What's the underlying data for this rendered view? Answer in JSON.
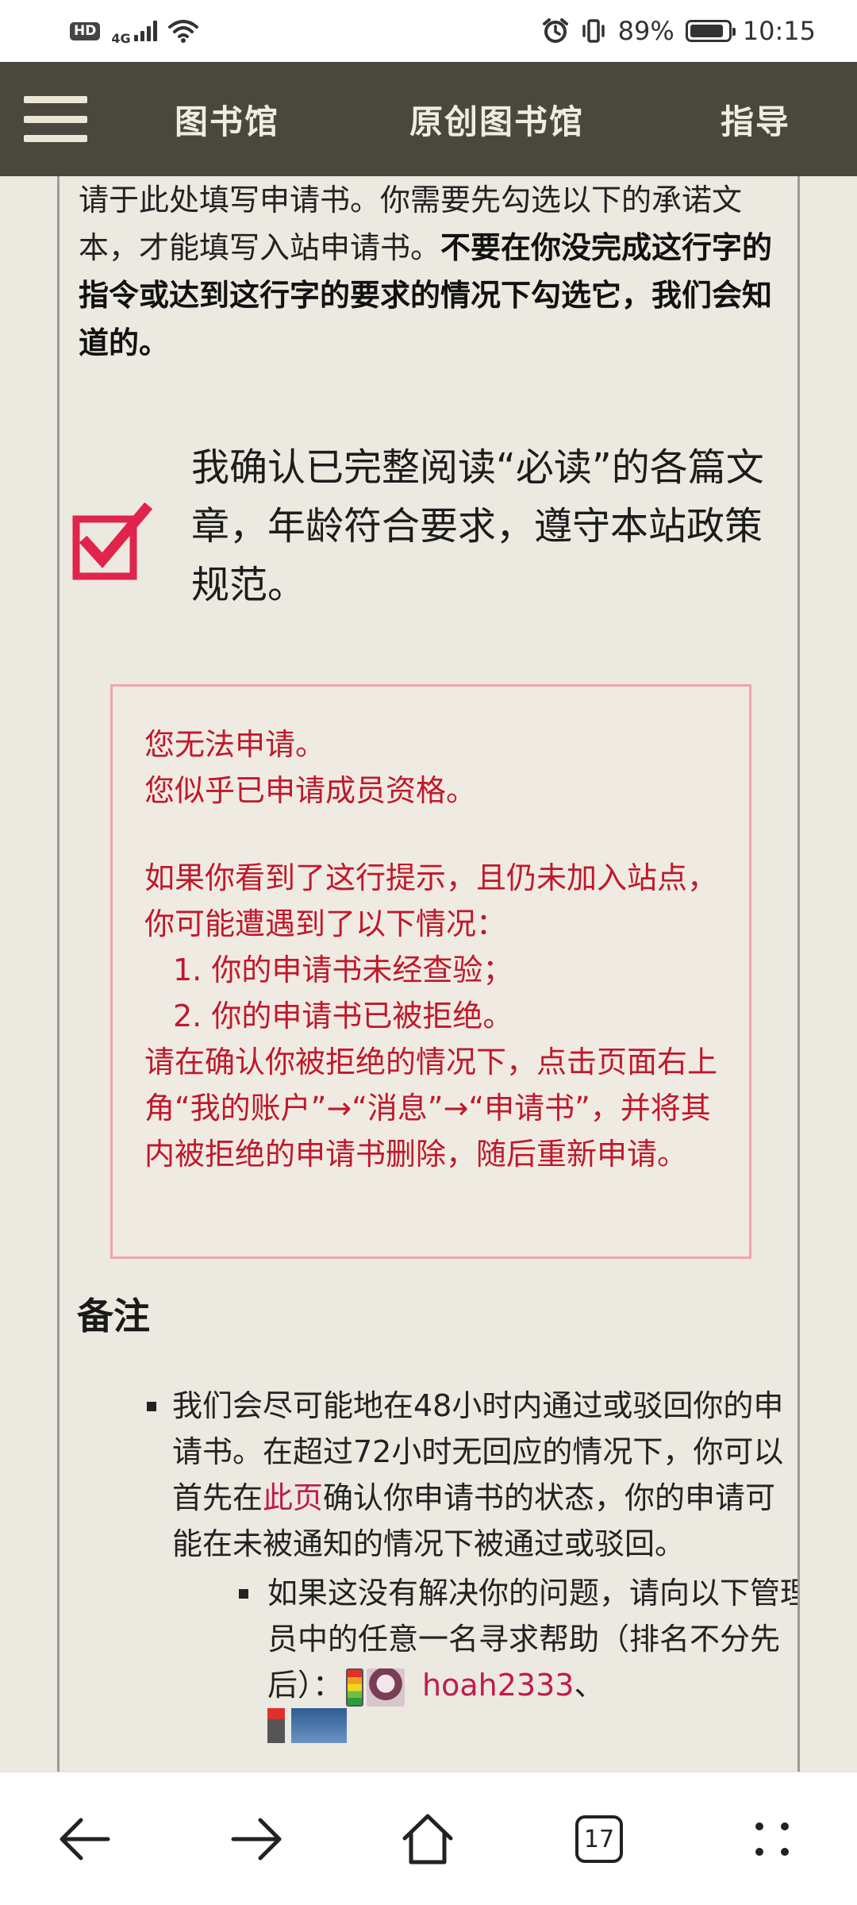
{
  "status_bar": {
    "hd": "HD",
    "network": "4G",
    "battery_text": "89%",
    "battery_level": 0.89,
    "time": "10:15"
  },
  "nav": {
    "menu_icon": "hamburger-icon",
    "links": [
      "图书馆",
      "原创图书馆",
      "指导"
    ]
  },
  "intro": {
    "text_plain": "请于此处填写申请书。你需要先勾选以下的承诺文本，才能填写入站申请书。",
    "text_bold": "不要在你没完成这行字的指令或达到这行字的要求的情况下勾选它，我们会知道的。"
  },
  "confirm": {
    "checked": true,
    "label": "我确认已完整阅读“必读”的各篇文章，年龄符合要求，遵守本站政策规范。"
  },
  "notice": {
    "line1": "您无法申请。",
    "line2": "您似乎已申请成员资格。",
    "para": "如果你看到了这行提示，且仍未加入站点，你可能遭遇到了以下情况：",
    "item1": "1. 你的申请书未经查验；",
    "item2": "2. 你的申请书已被拒绝。",
    "instruction": "请在确认你被拒绝的情况下，点击页面右上角“我的账户”→“消息”→“申请书”，并将其内被拒绝的申请书删除，随后重新申请。"
  },
  "notes": {
    "title": "备注",
    "item1_before": "我们会尽可能地在48小时内通过或驳回你的申请书。在超过72小时无回应的情况下，你可以首先在",
    "item1_link": "此页",
    "item1_after": "确认你申请书的状态，你的申请可能在未被通知的情况下被通过或驳回。",
    "sub_item_text": "如果这没有解决你的问题，请向以下管理员中的任意一名寻求帮助（排名不分先后）：",
    "admin_name": "hoah2333",
    "separator": "、"
  },
  "bottom_bar": {
    "tabs_count": "17",
    "icons": [
      "back-arrow-icon",
      "forward-arrow-icon",
      "home-icon",
      "tabs-icon",
      "more-icon"
    ]
  },
  "colors": {
    "nav_bg": "#4a473f",
    "page_bg": "#ece9e0",
    "notice_text": "#c0182b",
    "notice_border": "#efa5ad",
    "link": "#c01a4e",
    "checkbox": "#e0244b"
  }
}
